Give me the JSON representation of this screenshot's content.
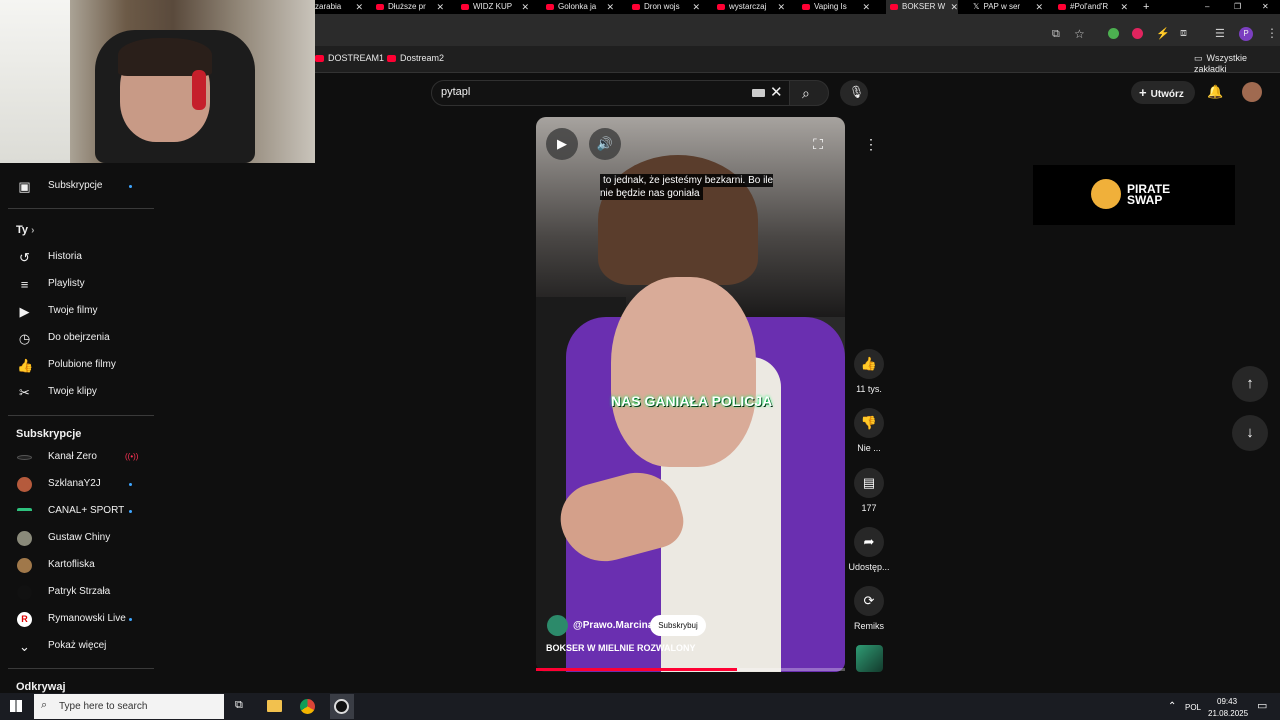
{
  "browser": {
    "tabs": [
      {
        "label": "zarabia",
        "active": false
      },
      {
        "label": "Dłuższe pr",
        "active": false
      },
      {
        "label": "WIDZ KUP",
        "active": false
      },
      {
        "label": "Golonka ja",
        "active": false
      },
      {
        "label": "Dron wojs",
        "active": false
      },
      {
        "label": "wystarczaj",
        "active": false
      },
      {
        "label": "Vaping Is",
        "active": false
      },
      {
        "label": "BOKSER W",
        "active": true
      },
      {
        "label": "PAP w ser",
        "active": false
      },
      {
        "label": "#Pol'and'R",
        "active": false
      }
    ],
    "bookmarks": [
      "DOSTREAM1",
      "Dostream2"
    ],
    "all_bookmarks": "Wszystkie zakładki"
  },
  "youtube": {
    "search_value": "pytapl",
    "create_label": "Utwórz",
    "sidebar": {
      "top_item": "Subskrypcje",
      "you_header": "Ty",
      "you_items": [
        {
          "label": "Historia",
          "icon": "history-icon"
        },
        {
          "label": "Playlisty",
          "icon": "playlist-icon"
        },
        {
          "label": "Twoje filmy",
          "icon": "video-icon"
        },
        {
          "label": "Do obejrzenia",
          "icon": "clock-icon"
        },
        {
          "label": "Polubione filmy",
          "icon": "thumbs-up-icon"
        },
        {
          "label": "Twoje klipy",
          "icon": "scissors-icon"
        }
      ],
      "subs_header": "Subskrypcje",
      "subs": [
        {
          "label": "Kanał Zero",
          "live": true
        },
        {
          "label": "SzklanaY2J",
          "dot": true
        },
        {
          "label": "CANAL+ SPORT",
          "dot": true
        },
        {
          "label": "Gustaw Chiny",
          "dot": false
        },
        {
          "label": "Kartofliska",
          "dot": false
        },
        {
          "label": "Patryk Strzała",
          "dot": false
        },
        {
          "label": "Rymanowski Live",
          "dot": true
        }
      ],
      "show_more": "Pokaż więcej",
      "explore_header": "Odkrywaj"
    },
    "short": {
      "subtitle": "to jednak, że jesteśmy bezkarni. Bo ile nie będzie nas goniała",
      "big_caption": "NAS GANIAŁA POLICJA",
      "channel": "@Prawo.Marcina",
      "subscribe": "Subskrybuj",
      "title": "BOKSER W MIELNIE ROZWALONY",
      "progress": 0.65
    },
    "actions": {
      "likes": "11 tys.",
      "dislike": "Nie ...",
      "comments": "177",
      "share": "Udostęp...",
      "remix": "Remiks"
    },
    "ad": {
      "line1": "PIRATE",
      "line2": "SWAP"
    }
  },
  "taskbar": {
    "search_placeholder": "Type here to search",
    "lang": "POL",
    "time": "09:43",
    "date": "21.08.2025"
  }
}
